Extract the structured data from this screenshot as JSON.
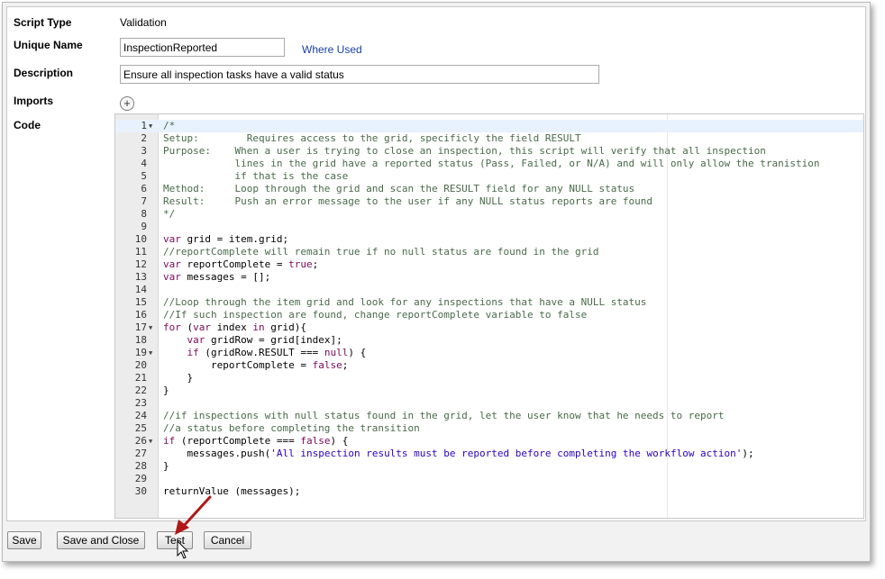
{
  "form": {
    "script_type_label": "Script Type",
    "script_type_value": "Validation",
    "unique_name_label": "Unique Name",
    "unique_name_value": "InspectionReported",
    "where_used_link": "Where Used",
    "description_label": "Description",
    "description_value": "Ensure all inspection tasks have a valid status",
    "imports_label": "Imports",
    "imports_add_icon": "plus-circle-icon",
    "code_label": "Code"
  },
  "code": [
    {
      "n": "1",
      "fold": true,
      "text": "/*"
    },
    {
      "n": "2",
      "fold": false,
      "text": "Setup:        Requires access to the grid, specificly the field RESULT"
    },
    {
      "n": "3",
      "fold": false,
      "text": "Purpose:    When a user is trying to close an inspection, this script will verify that all inspection"
    },
    {
      "n": "4",
      "fold": false,
      "text": "            lines in the grid have a reported status (Pass, Failed, or N/A) and will only allow the tranistion"
    },
    {
      "n": "5",
      "fold": false,
      "text": "            if that is the case"
    },
    {
      "n": "6",
      "fold": false,
      "text": "Method:     Loop through the grid and scan the RESULT field for any NULL status"
    },
    {
      "n": "7",
      "fold": false,
      "text": "Result:     Push an error message to the user if any NULL status reports are found"
    },
    {
      "n": "8",
      "fold": false,
      "text": "*/"
    },
    {
      "n": "9",
      "fold": false,
      "text": ""
    },
    {
      "n": "10",
      "fold": false,
      "text": "var grid = item.grid;"
    },
    {
      "n": "11",
      "fold": false,
      "text": "//reportComplete will remain true if no null status are found in the grid"
    },
    {
      "n": "12",
      "fold": false,
      "text": "var reportComplete = true;"
    },
    {
      "n": "13",
      "fold": false,
      "text": "var messages = [];"
    },
    {
      "n": "14",
      "fold": false,
      "text": ""
    },
    {
      "n": "15",
      "fold": false,
      "text": "//Loop through the item grid and look for any inspections that have a NULL status"
    },
    {
      "n": "16",
      "fold": false,
      "text": "//If such inspection are found, change reportComplete variable to false"
    },
    {
      "n": "17",
      "fold": true,
      "text": "for (var index in grid){"
    },
    {
      "n": "18",
      "fold": false,
      "text": "    var gridRow = grid[index];"
    },
    {
      "n": "19",
      "fold": true,
      "text": "    if (gridRow.RESULT === null) {"
    },
    {
      "n": "20",
      "fold": false,
      "text": "        reportComplete = false;"
    },
    {
      "n": "21",
      "fold": false,
      "text": "    }"
    },
    {
      "n": "22",
      "fold": false,
      "text": "}"
    },
    {
      "n": "23",
      "fold": false,
      "text": ""
    },
    {
      "n": "24",
      "fold": false,
      "text": "//if inspections with null status found in the grid, let the user know that he needs to report"
    },
    {
      "n": "25",
      "fold": false,
      "text": "//a status before completing the transition"
    },
    {
      "n": "26",
      "fold": true,
      "text": "if (reportComplete === false) {"
    },
    {
      "n": "27",
      "fold": false,
      "text": "    messages.push('All inspection results must be reported before completing the workflow action');"
    },
    {
      "n": "28",
      "fold": false,
      "text": "}"
    },
    {
      "n": "29",
      "fold": false,
      "text": ""
    },
    {
      "n": "30",
      "fold": false,
      "text": "returnValue (messages);"
    }
  ],
  "buttons": {
    "save": "Save",
    "save_and_close": "Save and Close",
    "test": "Test",
    "cancel": "Cancel"
  },
  "colors": {
    "annotation_arrow": "#b01818",
    "link": "#1a3fa0"
  }
}
